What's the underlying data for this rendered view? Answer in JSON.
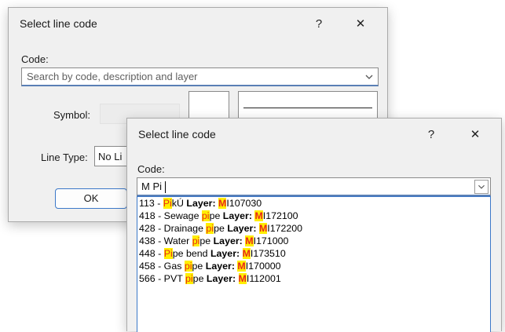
{
  "back_dialog": {
    "title": "Select line code",
    "help_label": "?",
    "close_label": "✕",
    "code_label": "Code:",
    "search_placeholder": "Search by code, description and layer",
    "symbol_label": "Symbol:",
    "line_type_label": "Line Type:",
    "line_type_value": "No Li",
    "ok_label": "OK"
  },
  "front_dialog": {
    "title": "Select line code",
    "help_label": "?",
    "close_label": "✕",
    "code_label": "Code:",
    "code_value": "M Pi"
  },
  "results": [
    {
      "code": "113 - ",
      "desc_hl": "Pi",
      "desc_rest": "kÚ ",
      "layer_label": "Layer: ",
      "layer_hl": "M",
      "layer_rest": "I107030"
    },
    {
      "code": "418 - Sewage ",
      "desc_hl": "pi",
      "desc_rest": "pe ",
      "layer_label": "Layer: ",
      "layer_hl": "M",
      "layer_rest": "I172100"
    },
    {
      "code": "428 - Drainage ",
      "desc_hl": "pi",
      "desc_rest": "pe ",
      "layer_label": "Layer: ",
      "layer_hl": "M",
      "layer_rest": "I172200"
    },
    {
      "code": "438 - Water ",
      "desc_hl": "pi",
      "desc_rest": "pe ",
      "layer_label": "Layer: ",
      "layer_hl": "M",
      "layer_rest": "I171000"
    },
    {
      "code": "448 - ",
      "desc_hl": "Pi",
      "desc_rest": "pe bend ",
      "layer_label": "Layer: ",
      "layer_hl": "M",
      "layer_rest": "I173510"
    },
    {
      "code": "458 - Gas ",
      "desc_hl": "pi",
      "desc_rest": "pe ",
      "layer_label": "Layer: ",
      "layer_hl": "M",
      "layer_rest": "I170000"
    },
    {
      "code": "566 - PVT ",
      "desc_hl": "pi",
      "desc_rest": "pe ",
      "layer_label": "Layer: ",
      "layer_hl": "M",
      "layer_rest": "I112001"
    }
  ],
  "colors": {
    "highlight_bg": "#ffee00",
    "highlight_text": "#e8291c",
    "focus_border": "#3c78c8"
  }
}
